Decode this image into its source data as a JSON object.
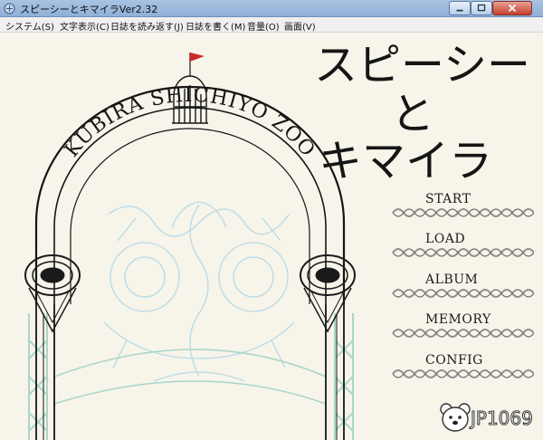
{
  "window": {
    "title": "スピーシーとキマイラVer2.32"
  },
  "menubar": {
    "items": [
      "システム(S)",
      "文字表示(C)",
      "日誌を読み返す(J)",
      "日誌を書く(M)",
      "音量(O)",
      "画面(V)"
    ]
  },
  "game": {
    "title_lines": [
      "スピーシー",
      "と",
      "キマイラ"
    ],
    "arch_text": "KUBIRA SHICHIYO ZOO",
    "menu": [
      "START",
      "LOAD",
      "ALBUM",
      "MEMORY",
      "CONFIG"
    ]
  },
  "watermark": {
    "text": "JP1069"
  },
  "colors": {
    "background": "#f7f4ea",
    "ink": "#151515",
    "mint": "#a9d6c8",
    "ice_blue": "#b6dbe6",
    "flag_red": "#cc2a2a"
  }
}
